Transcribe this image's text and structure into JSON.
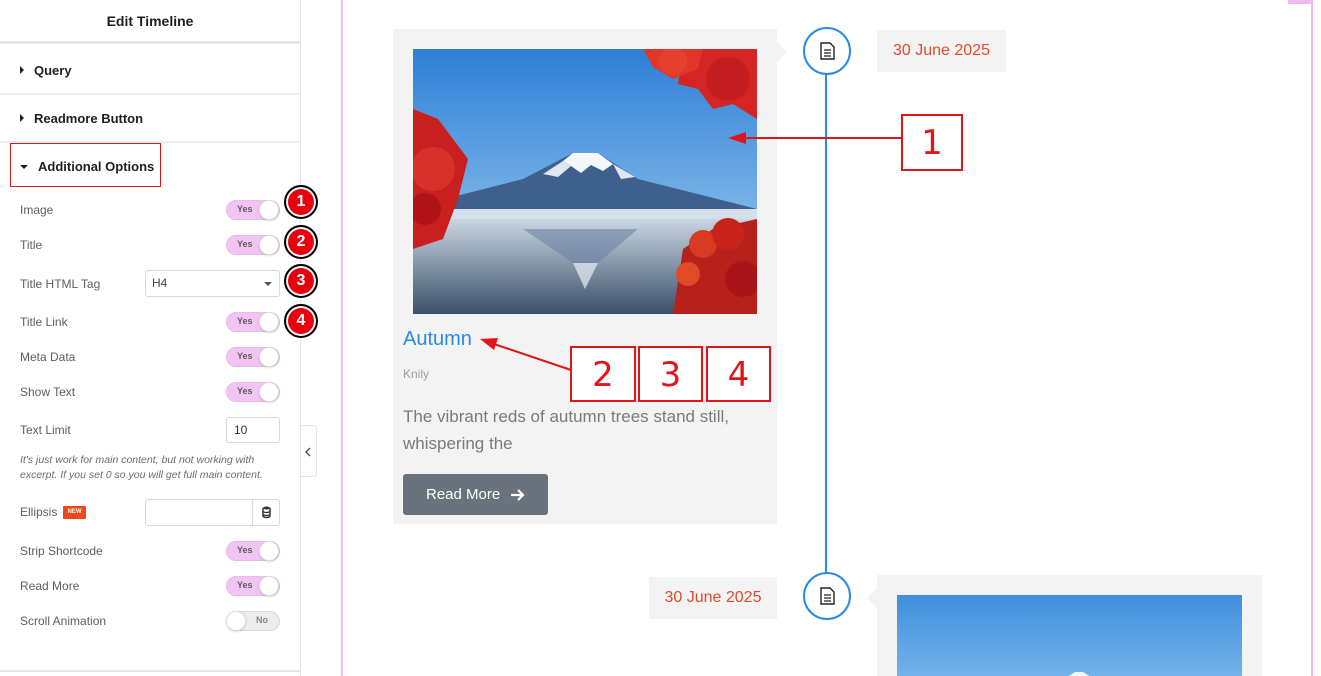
{
  "panel": {
    "title": "Edit Timeline",
    "sections": {
      "query": "Query",
      "readmore_button": "Readmore Button",
      "additional_options": "Additional Options"
    },
    "controls": {
      "image": {
        "label": "Image",
        "value": "Yes"
      },
      "title": {
        "label": "Title",
        "value": "Yes"
      },
      "title_html_tag": {
        "label": "Title HTML Tag",
        "value": "H4"
      },
      "title_link": {
        "label": "Title Link",
        "value": "Yes"
      },
      "meta_data": {
        "label": "Meta Data",
        "value": "Yes"
      },
      "show_text": {
        "label": "Show Text",
        "value": "Yes"
      },
      "text_limit": {
        "label": "Text Limit",
        "value": "10"
      },
      "help_text": "It's just work for main content, but not working with excerpt. If you set 0 so you will get full main content.",
      "ellipsis": {
        "label": "Ellipsis",
        "badge": "NEW",
        "value": ""
      },
      "strip_shortcode": {
        "label": "Strip Shortcode",
        "value": "Yes"
      },
      "read_more": {
        "label": "Read More",
        "value": "Yes"
      },
      "scroll_animation": {
        "label": "Scroll Animation",
        "value": "No"
      }
    },
    "badges": [
      "1",
      "2",
      "3",
      "4"
    ]
  },
  "preview": {
    "item1": {
      "date": "30 June 2025",
      "title": "Autumn",
      "meta": "Knily",
      "text": "The vibrant reds of autumn trees stand still, whispering the",
      "button": "Read More"
    },
    "item2": {
      "date": "30 June 2025"
    },
    "callouts": [
      "1",
      "2",
      "3",
      "4"
    ]
  },
  "colors": {
    "accent_blue": "#2b8be4",
    "date_red": "#e24a2b",
    "toggle_on": "#f2c4f3",
    "highlight_red": "#e0151a",
    "frame_pink": "#f1b9f2"
  }
}
